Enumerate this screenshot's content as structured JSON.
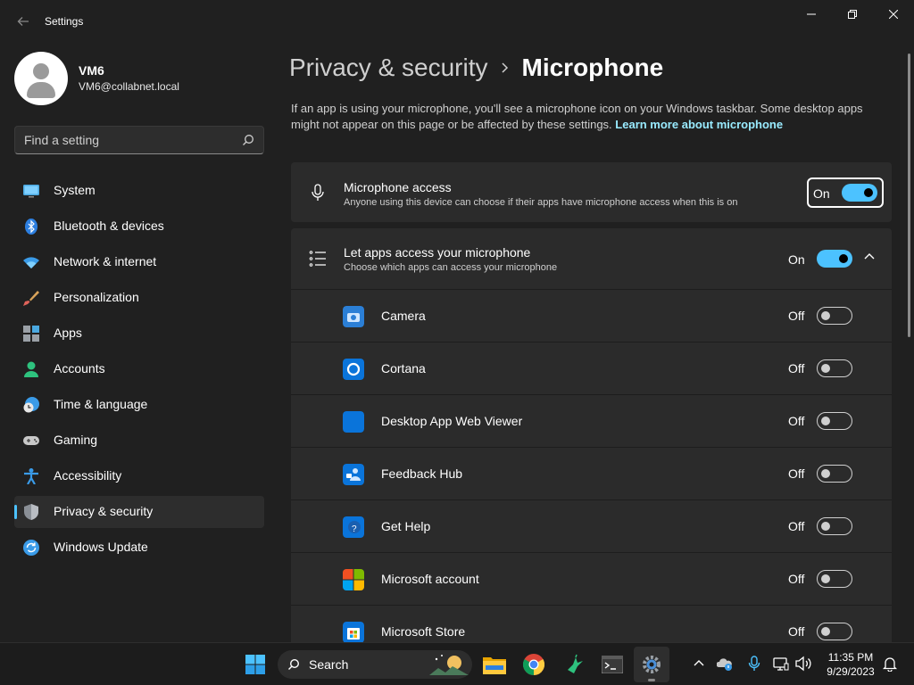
{
  "window": {
    "title": "Settings"
  },
  "profile": {
    "name": "VM6",
    "email": "VM6@collabnet.local"
  },
  "search": {
    "placeholder": "Find a setting"
  },
  "nav": [
    {
      "label": "System",
      "icon": "monitor-icon"
    },
    {
      "label": "Bluetooth & devices",
      "icon": "bluetooth-icon"
    },
    {
      "label": "Network & internet",
      "icon": "wifi-icon"
    },
    {
      "label": "Personalization",
      "icon": "brush-icon"
    },
    {
      "label": "Apps",
      "icon": "apps-icon"
    },
    {
      "label": "Accounts",
      "icon": "person-icon"
    },
    {
      "label": "Time & language",
      "icon": "globe-clock-icon"
    },
    {
      "label": "Gaming",
      "icon": "gamepad-icon"
    },
    {
      "label": "Accessibility",
      "icon": "accessibility-icon"
    },
    {
      "label": "Privacy & security",
      "icon": "shield-icon",
      "active": true
    },
    {
      "label": "Windows Update",
      "icon": "update-icon"
    }
  ],
  "breadcrumb": {
    "parent": "Privacy & security",
    "current": "Microphone"
  },
  "description": {
    "text": "If an app is using your microphone, you'll see a microphone icon on your Windows taskbar. Some desktop apps might not appear on this page or be affected by these settings.",
    "link": "Learn more about microphone"
  },
  "microphone_access": {
    "title": "Microphone access",
    "subtitle": "Anyone using this device can choose if their apps have microphone access when this is on",
    "state": "On"
  },
  "let_apps": {
    "title": "Let apps access your microphone",
    "subtitle": "Choose which apps can access your microphone",
    "state": "On"
  },
  "apps": [
    {
      "name": "Camera",
      "state": "Off",
      "icon": "camera-app-icon"
    },
    {
      "name": "Cortana",
      "state": "Off",
      "icon": "cortana-app-icon"
    },
    {
      "name": "Desktop App Web Viewer",
      "state": "Off",
      "icon": "web-viewer-app-icon"
    },
    {
      "name": "Feedback Hub",
      "state": "Off",
      "icon": "feedback-hub-app-icon"
    },
    {
      "name": "Get Help",
      "state": "Off",
      "icon": "get-help-app-icon"
    },
    {
      "name": "Microsoft account",
      "state": "Off",
      "icon": "microsoft-account-app-icon"
    },
    {
      "name": "Microsoft Store",
      "state": "Off",
      "icon": "microsoft-store-app-icon"
    }
  ],
  "taskbar": {
    "search_label": "Search",
    "time": "11:35 PM",
    "date": "9/29/2023"
  },
  "colors": {
    "accent": "#4cc2ff",
    "background": "#202020",
    "card": "#2b2b2b",
    "link": "#99ebff"
  }
}
